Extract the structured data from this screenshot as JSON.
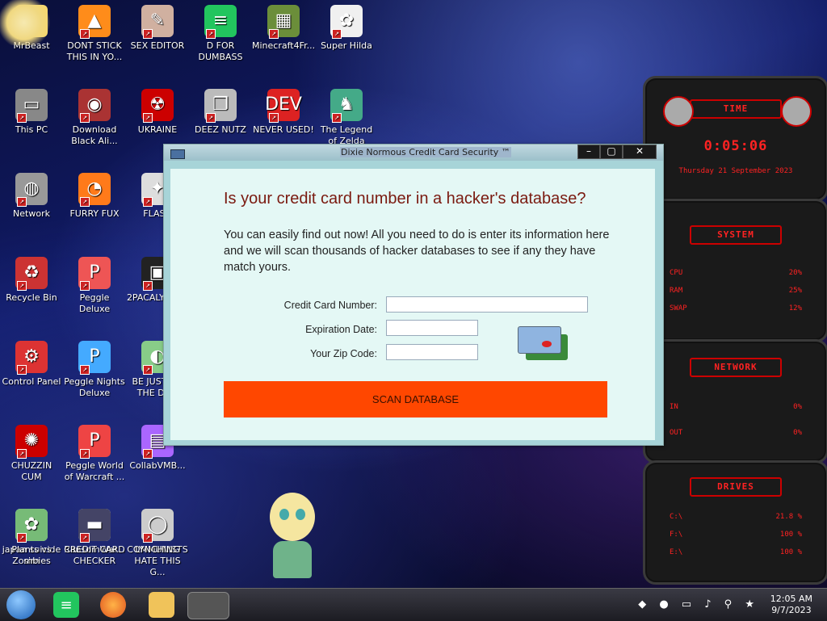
{
  "desktop_icons": [
    {
      "label": "MrBeast",
      "glyph": "☺"
    },
    {
      "label": "DONT STICK THIS IN YO...",
      "glyph": "▲"
    },
    {
      "label": "SEX EDITOR",
      "glyph": "✎"
    },
    {
      "label": "D FOR DUMBASS",
      "glyph": "≡"
    },
    {
      "label": "Minecraft4Fr...",
      "glyph": "▦"
    },
    {
      "label": "Super Hilda",
      "glyph": "✿"
    },
    {
      "label": "This PC",
      "glyph": "▭"
    },
    {
      "label": "Download Black Ali...",
      "glyph": "◉"
    },
    {
      "label": "UKRAINE",
      "glyph": "☢"
    },
    {
      "label": "DEEZ NUTZ",
      "glyph": "❐"
    },
    {
      "label": "NEVER USED!",
      "glyph": "DEV"
    },
    {
      "label": "The Legend of Zelda",
      "glyph": "♞"
    },
    {
      "label": "Network",
      "glyph": "◍"
    },
    {
      "label": "FURRY FUX",
      "glyph": "◔"
    },
    {
      "label": "FLASH",
      "glyph": "✦"
    },
    {
      "label": "Recycle Bin",
      "glyph": "♻"
    },
    {
      "label": "Peggle Deluxe",
      "glyph": "P"
    },
    {
      "label": "2PACALY... 2.3",
      "glyph": "▣"
    },
    {
      "label": "Control Panel",
      "glyph": "⚙"
    },
    {
      "label": "Peggle Nights Deluxe",
      "glyph": "P"
    },
    {
      "label": "BE JUST L... THE DUD",
      "glyph": "◐"
    },
    {
      "label": "CHUZZIN CUM",
      "glyph": "✺"
    },
    {
      "label": "Peggle World of Warcraft ...",
      "glyph": "P"
    },
    {
      "label": "CollabVMB...",
      "glyph": "▤"
    },
    {
      "label": "japan suicide sim",
      "glyph": "↓↓"
    },
    {
      "label": "RansomWar...",
      "glyph": "☠"
    },
    {
      "label": "COMMUNISTS HATE THIS G...",
      "glyph": "$"
    },
    {
      "label": "Plants vs Zombies",
      "glyph": "✿"
    },
    {
      "label": "CREDIT CARD CHECKER",
      "glyph": "▬"
    },
    {
      "label": "LYNCHING",
      "glyph": "◯"
    }
  ],
  "widget": {
    "time_title": "TIME",
    "time_value": "0:05:06",
    "date_value": "Thursday 21 September 2023",
    "system_title": "SYSTEM",
    "cpu_label": "CPU",
    "cpu_value": "20%",
    "ram_label": "RAM",
    "ram_value": "25%",
    "swap_label": "SWAP",
    "swap_value": "12%",
    "network_title": "NETWORK",
    "in_label": "IN",
    "in_value": "0%",
    "out_label": "OUT",
    "out_value": "0%",
    "drives_title": "DRIVES",
    "drive_c": "C:\\",
    "drive_c_value": "21.8 %",
    "drive_f": "F:\\",
    "drive_f_value": "100 %",
    "drive_e": "E:\\",
    "drive_e_value": "100 %"
  },
  "window": {
    "title": "Dixie Normous Credit Card Security ™",
    "heading": "Is your credit card number in a hacker's database?",
    "description": "You can easily find out now! All you need to do is enter its information here and we will scan thousands of hacker databases to see if any they have match yours.",
    "card_label": "Credit Card Number:",
    "card_value": "",
    "exp_label": "Expiration Date:",
    "exp_value": "",
    "zip_label": "Your Zip Code:",
    "zip_value": "",
    "scan_label": "SCAN DATABASE",
    "min_label": "–",
    "max_label": "▢",
    "close_label": "✕"
  },
  "taskbar": {
    "clock_time": "12:05 AM",
    "clock_date": "9/7/2023"
  },
  "colors": {
    "scan_button": "#ff4700",
    "heading": "#7a1a10",
    "client_bg": "#e4f8f5",
    "widget_red": "#ff2222"
  }
}
